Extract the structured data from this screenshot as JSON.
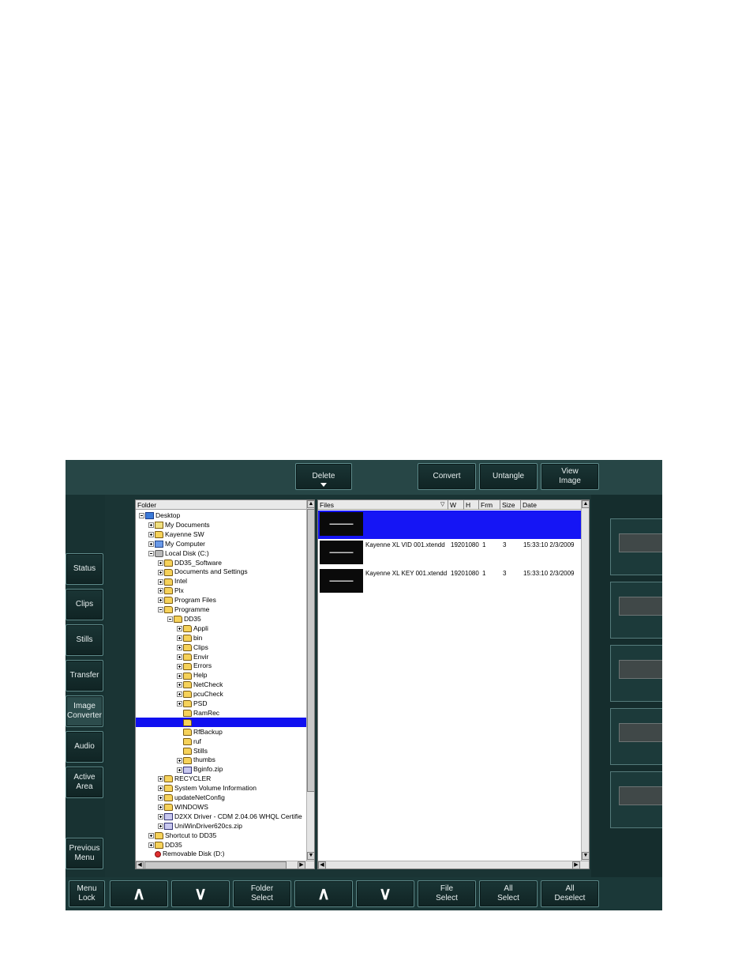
{
  "top_buttons": {
    "delete": "Delete",
    "convert": "Convert",
    "untangle": "Untangle",
    "view_image": "View\nImage"
  },
  "side_tabs": [
    "Status",
    "Clips",
    "Stills",
    "Transfer",
    "Image\nConverter",
    "Audio",
    "Active\nArea",
    "Previous\nMenu"
  ],
  "folder_pane": {
    "header": "Folder",
    "items": [
      {
        "label": "Desktop",
        "toggle": "minus",
        "icon": "desktop"
      },
      {
        "label": "My Documents",
        "toggle": "plus",
        "icon": "docs"
      },
      {
        "label": "Kayenne SW",
        "toggle": "plus",
        "icon": "folder"
      },
      {
        "label": "My Computer",
        "toggle": "plus",
        "icon": "computer"
      },
      {
        "label": "Local Disk (C:)",
        "toggle": "minus",
        "icon": "drive"
      },
      {
        "label": "DD35_Software",
        "toggle": "plus",
        "icon": "folder"
      },
      {
        "label": "Documents and Settings",
        "toggle": "plus",
        "icon": "folder"
      },
      {
        "label": "Intel",
        "toggle": "plus",
        "icon": "folder"
      },
      {
        "label": "Plx",
        "toggle": "plus",
        "icon": "folder"
      },
      {
        "label": "Program Files",
        "toggle": "plus",
        "icon": "folder"
      },
      {
        "label": "Programme",
        "toggle": "minus",
        "icon": "folder"
      },
      {
        "label": "DD35",
        "toggle": "minus",
        "icon": "folder"
      },
      {
        "label": "Appli",
        "toggle": "plus",
        "icon": "folder"
      },
      {
        "label": "bin",
        "toggle": "plus",
        "icon": "folder"
      },
      {
        "label": "Clips",
        "toggle": "plus",
        "icon": "folder"
      },
      {
        "label": "Envir",
        "toggle": "plus",
        "icon": "folder"
      },
      {
        "label": "Errors",
        "toggle": "plus",
        "icon": "folder"
      },
      {
        "label": "Help",
        "toggle": "plus",
        "icon": "folder"
      },
      {
        "label": "NetCheck",
        "toggle": "plus",
        "icon": "folder"
      },
      {
        "label": "pcuCheck",
        "toggle": "plus",
        "icon": "folder"
      },
      {
        "label": "PSD",
        "toggle": "plus",
        "icon": "folder"
      },
      {
        "label": "RamRec",
        "toggle": "",
        "icon": "folder"
      },
      {
        "label": "",
        "toggle": "",
        "icon": "folder",
        "selected": true
      },
      {
        "label": "RfBackup",
        "toggle": "",
        "icon": "folder"
      },
      {
        "label": "ruf",
        "toggle": "",
        "icon": "folder"
      },
      {
        "label": "Stills",
        "toggle": "",
        "icon": "folder"
      },
      {
        "label": "thumbs",
        "toggle": "plus",
        "icon": "folder"
      },
      {
        "label": "Bginfo.zip",
        "toggle": "plus",
        "icon": "file"
      },
      {
        "label": "RECYCLER",
        "toggle": "plus",
        "icon": "folder"
      },
      {
        "label": "System Volume Information",
        "toggle": "plus",
        "icon": "folder"
      },
      {
        "label": "updateNetConfig",
        "toggle": "plus",
        "icon": "folder"
      },
      {
        "label": "WINDOWS",
        "toggle": "plus",
        "icon": "folder"
      },
      {
        "label": "D2XX Driver - CDM 2.04.06 WHQL Certifie",
        "toggle": "plus",
        "icon": "file"
      },
      {
        "label": "UniWinDriver620cs.zip",
        "toggle": "plus",
        "icon": "file"
      },
      {
        "label": "Shortcut to DD35",
        "toggle": "plus",
        "icon": "folder"
      },
      {
        "label": "DD35",
        "toggle": "plus",
        "icon": "folder"
      },
      {
        "label": "Removable Disk (D:)",
        "toggle": "",
        "icon": "disk"
      }
    ]
  },
  "files_pane": {
    "columns": [
      "Files",
      "W",
      "H",
      "Frm",
      "Size",
      "Date"
    ],
    "rows": [
      {
        "name": "",
        "w": "",
        "h": "",
        "frm": "",
        "size": "",
        "date": "",
        "selected": true
      },
      {
        "name": "Kayenne XL VID 001.xtendd",
        "w": "1920",
        "h": "1080",
        "frm": "1",
        "size": "3",
        "date": "15:33:10 2/3/2009"
      },
      {
        "name": "Kayenne XL KEY 001.xtendd",
        "w": "1920",
        "h": "1080",
        "frm": "1",
        "size": "3",
        "date": "15:33:10 2/3/2009"
      }
    ]
  },
  "bottom_buttons": {
    "menu_lock": "Menu\nLock",
    "folder_select": "Folder\nSelect",
    "file_select": "File\nSelect",
    "all_select": "All\nSelect",
    "all_deselect": "All\nDeselect"
  },
  "colors": {
    "panel_bg": "#1f3b3b",
    "selection": "#1010f0",
    "button_border": "#5e8a8a"
  }
}
